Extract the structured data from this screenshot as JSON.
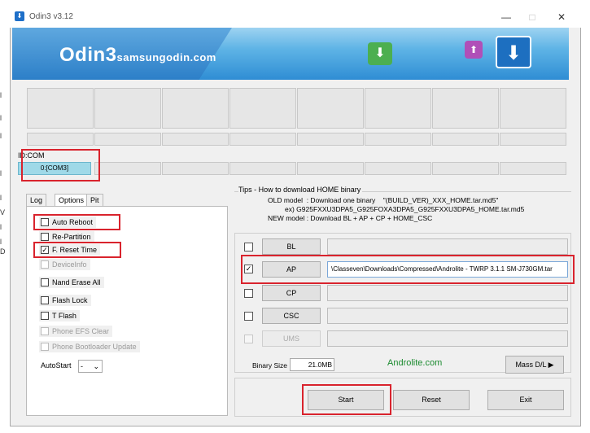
{
  "window": {
    "title": "Odin3 v3.12",
    "minimize": "—",
    "maximize": "□",
    "close": "✕"
  },
  "banner": {
    "brand": "Odin3",
    "site": "samsungodin.com",
    "icons": [
      "download-arrow-icon",
      "upload-arrow-icon",
      "download-arrow-icon"
    ]
  },
  "ports": {
    "id_label": "ID:COM",
    "active_port": "0:[COM3]"
  },
  "tabs": [
    "Log",
    "Options",
    "Pit"
  ],
  "options": {
    "auto_reboot": "Auto Reboot",
    "re_partition": "Re-Partition",
    "f_reset_time": "F. Reset Time",
    "f_reset_check": "✓",
    "device_info": "DeviceInfo",
    "nand_erase_all": "Nand Erase All",
    "flash_lock": "Flash Lock",
    "t_flash": "T Flash",
    "phone_efs_clear": "Phone EFS Clear",
    "phone_bootloader_update": "Phone Bootloader Update",
    "autostart_label": "AutoStart",
    "autostart_value": "-"
  },
  "tips": {
    "title": "Tips - How to download HOME binary",
    "line1": "OLD model  : Download one binary    \"(BUILD_VER)_XXX_HOME.tar.md5\"",
    "line2": "ex) G925FXXU3DPA5_G925FOXA3DPA5_G925FXXU3DPA5_HOME.tar.md5",
    "line3": "NEW model : Download BL + AP + CP + HOME_CSC"
  },
  "files": {
    "bl_label": "BL",
    "ap_label": "AP",
    "ap_check": "✓",
    "ap_path": "\\Classeven\\Downloads\\Compressed\\Androlite - TWRP 3.1.1 SM-J730GM.tar",
    "cp_label": "CP",
    "csc_label": "CSC",
    "ums_label": "UMS"
  },
  "binary_size": {
    "label": "Binary Size",
    "value": "21.0MB"
  },
  "watermark": "Androlite.com",
  "mass_dl": "Mass D/L ▶",
  "buttons": {
    "start": "Start",
    "reset": "Reset",
    "exit": "Exit"
  },
  "background_page": {
    "fragments": [
      "l",
      "l",
      "l",
      "l",
      "l",
      "V",
      "l",
      "l",
      "D"
    ]
  }
}
